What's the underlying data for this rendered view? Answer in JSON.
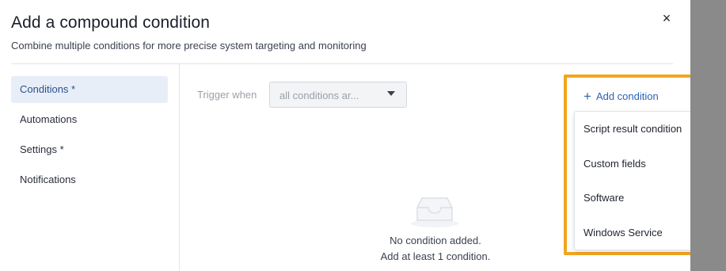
{
  "dialog": {
    "title": "Add a compound condition",
    "subtitle": "Combine multiple conditions for more precise system targeting and monitoring",
    "close_symbol": "×"
  },
  "sidebar": {
    "items": [
      {
        "label": "Conditions *",
        "active": true
      },
      {
        "label": "Automations",
        "active": false
      },
      {
        "label": "Settings *",
        "active": false
      },
      {
        "label": "Notifications",
        "active": false
      }
    ]
  },
  "trigger": {
    "label": "Trigger when",
    "selected_value": "all conditions ar..."
  },
  "add_condition": {
    "label": "Add condition",
    "icon": "plus-icon",
    "menu": [
      "Script result condition",
      "Custom fields",
      "Software",
      "Windows Service"
    ]
  },
  "empty_state": {
    "icon": "empty-inbox-icon",
    "title": "No condition added.",
    "hint": "Add at least 1 condition."
  },
  "colors": {
    "highlight": "#f2a51f",
    "link": "#2c63b5",
    "active_nav_bg": "#e8eef8",
    "overlay": "#8a8a8a"
  }
}
